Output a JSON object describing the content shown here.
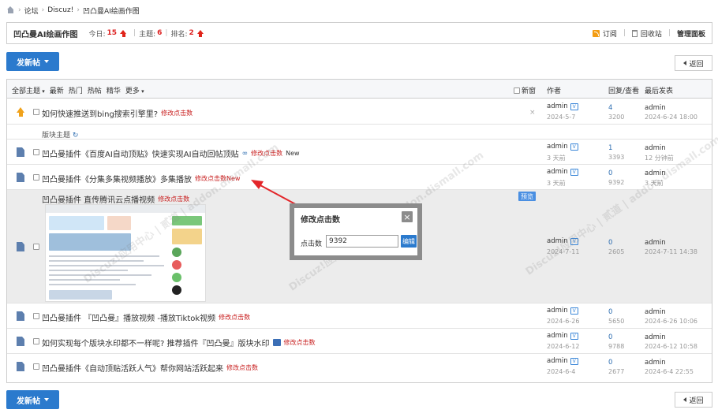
{
  "breadcrumb": {
    "items": [
      "论坛",
      "Discuz!",
      "凹凸曼AI绘画作图"
    ],
    "sep": "›"
  },
  "forum": {
    "title": "凹凸曼AI绘画作图",
    "today_label": "今日:",
    "today_value": "15",
    "topics_label": "主题:",
    "topics_value": "6",
    "rank_label": "排名:",
    "rank_value": "2",
    "subscribe": "订阅",
    "recycle": "回收站",
    "admin_panel": "管理面板",
    "accent": "#e0241a"
  },
  "buttons": {
    "post": "发新帖",
    "back": "返回"
  },
  "table_header": {
    "filters": [
      "全部主题",
      "最新",
      "热门",
      "热帖",
      "精华",
      "更多"
    ],
    "new_window": "新窗",
    "author": "作者",
    "replies_views": "回复/查看",
    "last_post": "最后发表"
  },
  "section": {
    "label": "版块主题"
  },
  "threads": [
    {
      "title": "如何快速推送到bing搜索引擎里?",
      "edit": "修改点击数",
      "author": "admin",
      "date": "2024-5-7",
      "replies": "4",
      "views": "3200",
      "last_user": "admin",
      "last_date": "2024-6-24 18:00",
      "pinned": true
    },
    {
      "title": "凹凸曼插件《百度AI自动顶贴》快速实现AI自动回帖顶贴",
      "edit": "修改点击数",
      "new_tag": "New",
      "author": "admin",
      "date": "3 天前",
      "replies": "1",
      "views": "3393",
      "last_user": "admin",
      "last_date": "12 分钟前"
    },
    {
      "title": "凹凸曼插件《分集多集视频播放》多集播放",
      "edit": "修改点击数",
      "new_tag": "New",
      "author": "admin",
      "date": "3 天前",
      "replies": "0",
      "views": "9392",
      "last_user": "admin",
      "last_date": "3 天前"
    },
    {
      "title": "凹凸曼插件 直传腾讯云点播视频",
      "edit": "修改点击数",
      "preview": "预览",
      "author": "admin",
      "date": "2024-7-11",
      "replies": "0",
      "views": "2605",
      "last_user": "admin",
      "last_date": "2024-7-11 14:38"
    },
    {
      "title": "凹凸曼插件 『凹凸曼』播放视频 -播放Tiktok视频",
      "edit": "修改点击数",
      "author": "admin",
      "date": "2024-6-26",
      "replies": "0",
      "views": "5650",
      "last_user": "admin",
      "last_date": "2024-6-26 10:06"
    },
    {
      "title": "如何实现每个版块水印都不一样呢? 推荐插件『凹凸曼』版块水印",
      "edit": "修改点击数",
      "author": "admin",
      "date": "2024-6-12",
      "replies": "0",
      "views": "9788",
      "last_user": "admin",
      "last_date": "2024-6-12 10:58"
    },
    {
      "title": "凹凸曼插件《自动顶贴活跃人气》帮你网站活跃起来",
      "edit": "修改点击数",
      "author": "admin",
      "date": "2024-6-4",
      "replies": "0",
      "views": "2677",
      "last_user": "admin",
      "last_date": "2024-6-4 22:55"
    }
  ],
  "modal": {
    "title": "修改点击数",
    "label": "点击数",
    "value": "9392",
    "submit": "编辑",
    "close": "×"
  },
  "watermark": {
    "text": "Discuz!应用中心 | 贰道 | addon.dismall.com"
  }
}
